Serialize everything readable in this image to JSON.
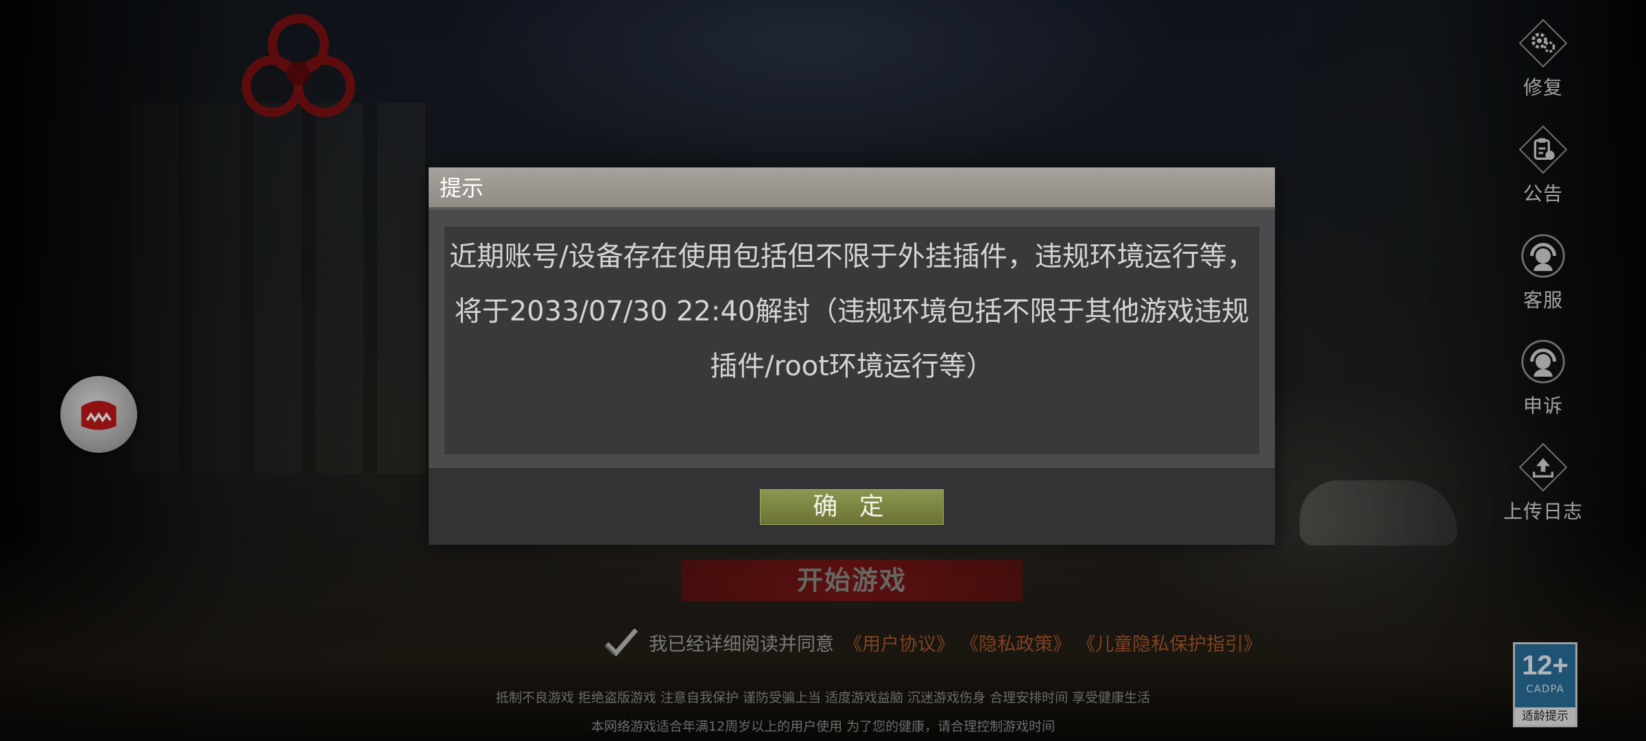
{
  "side_menu": {
    "items": [
      {
        "label": "修复",
        "icon": "gear-icon"
      },
      {
        "label": "公告",
        "icon": "announcement-icon"
      },
      {
        "label": "客服",
        "icon": "headset-icon"
      },
      {
        "label": "申诉",
        "icon": "appeal-headset-icon"
      },
      {
        "label": "上传日志",
        "icon": "upload-icon"
      }
    ]
  },
  "start_button": {
    "label": "开始游戏"
  },
  "agreement": {
    "text": "我已经详细阅读并同意",
    "user_agreement": "《用户协议》",
    "privacy_policy": "《隐私政策》",
    "child_privacy": "《儿童隐私保护指引》"
  },
  "footer": {
    "line1": "抵制不良游戏 拒绝盗版游戏 注意自我保护 谨防受骗上当 适度游戏益脑 沉迷游戏伤身 合理安排时间 享受健康生活",
    "line2": "本网络游戏适合年满12周岁以上的用户使用    为了您的健康，请合理控制游戏时间"
  },
  "age_badge": {
    "rating": "12+",
    "org": "CADPA",
    "tip": "适龄提示"
  },
  "dialog": {
    "title": "提示",
    "message": "近期账号/设备存在使用包括但不限于外挂插件，违规环境运行等，将于2033/07/30 22:40解封（违规环境包括不限于其他游戏违规插件/root环境运行等）",
    "confirm_label": "确 定"
  },
  "colors": {
    "confirm_button": "#7d8642",
    "start_button": "#7e1212",
    "link": "#a8582d",
    "age_badge": "#2a6f9a"
  }
}
